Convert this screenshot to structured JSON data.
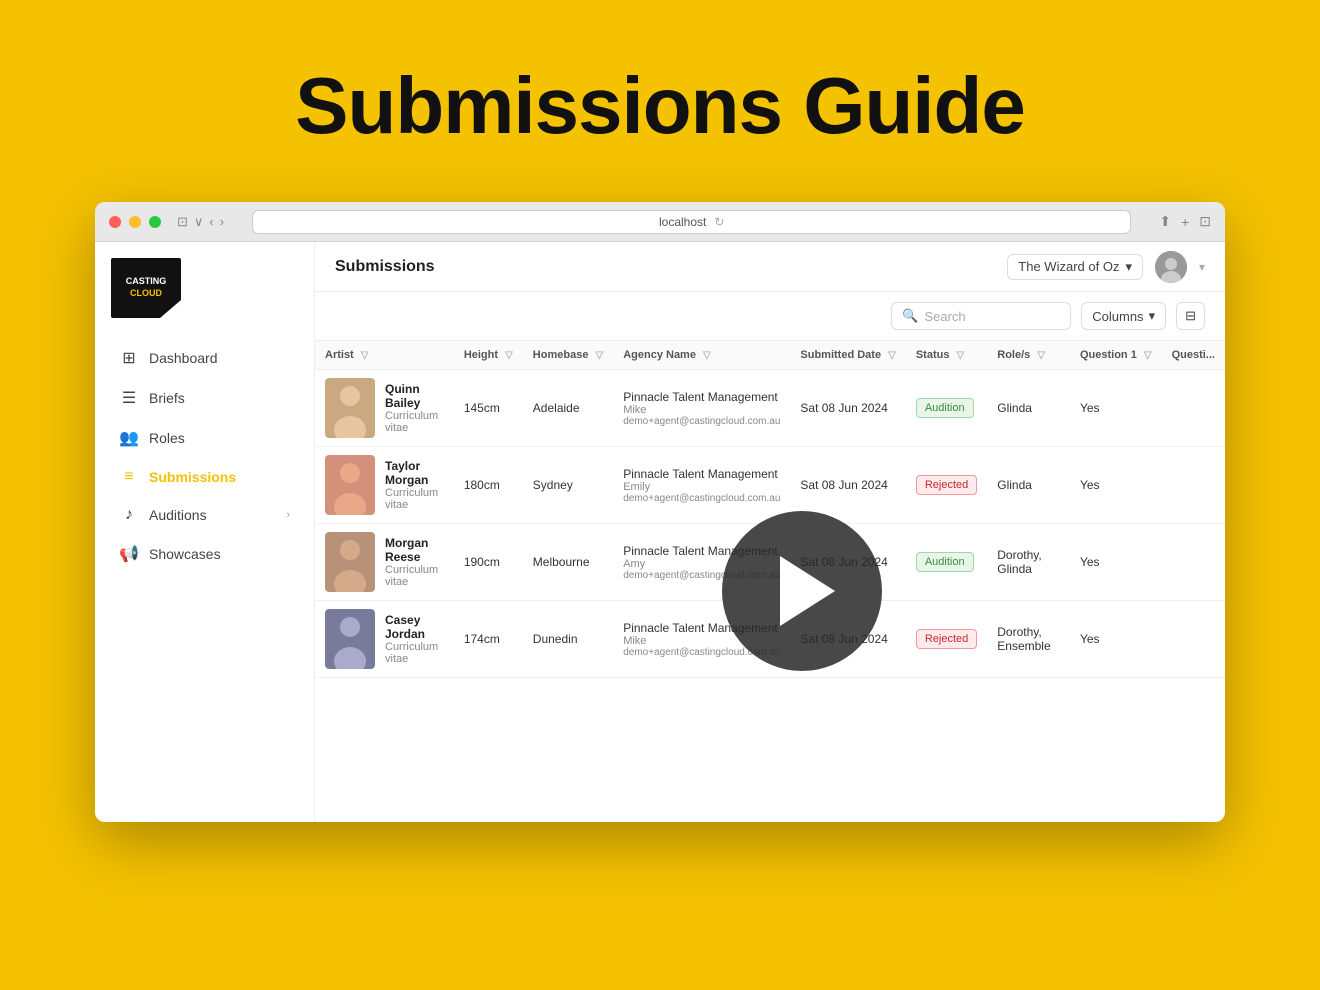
{
  "hero": {
    "title": "Submissions Guide"
  },
  "browser": {
    "url": "localhost",
    "traffic_lights": [
      "red",
      "yellow",
      "green"
    ]
  },
  "topbar": {
    "page_title": "Submissions",
    "project_name": "The Wizard of Oz",
    "user_initial": "👤"
  },
  "toolbar": {
    "search_placeholder": "Search",
    "columns_label": "Columns",
    "filter_icon": "▦"
  },
  "sidebar": {
    "logo_line1": "CASTING",
    "logo_line2": "CLOUD",
    "items": [
      {
        "id": "dashboard",
        "label": "Dashboard",
        "icon": "⊞",
        "active": false
      },
      {
        "id": "briefs",
        "label": "Briefs",
        "icon": "☰",
        "active": false
      },
      {
        "id": "roles",
        "label": "Roles",
        "icon": "👥",
        "active": false
      },
      {
        "id": "submissions",
        "label": "Submissions",
        "icon": "☰",
        "active": true
      },
      {
        "id": "auditions",
        "label": "Auditions",
        "icon": "♪",
        "active": false,
        "hasChevron": true
      },
      {
        "id": "showcases",
        "label": "Showcases",
        "icon": "📢",
        "active": false
      }
    ]
  },
  "table": {
    "columns": [
      {
        "id": "artist",
        "label": "Artist"
      },
      {
        "id": "height",
        "label": "Height"
      },
      {
        "id": "homebase",
        "label": "Homebase"
      },
      {
        "id": "agency_name",
        "label": "Agency Name"
      },
      {
        "id": "submitted_date",
        "label": "Submitted Date"
      },
      {
        "id": "status",
        "label": "Status"
      },
      {
        "id": "roles",
        "label": "Role/s"
      },
      {
        "id": "question1",
        "label": "Question 1"
      },
      {
        "id": "question2",
        "label": "Questi..."
      }
    ],
    "rows": [
      {
        "id": 1,
        "artist_name": "Quinn Bailey",
        "artist_sub": "Curriculum vitae",
        "photo_class": "artist-photo-1",
        "height": "145cm",
        "homebase": "Adelaide",
        "agency_name": "Pinnacle Talent Management",
        "agency_contact": "Mike",
        "agency_email": "demo+agent@castingcloud.com.au",
        "submitted_date": "Sat 08 Jun 2024",
        "status": "Audition",
        "status_class": "status-audition",
        "roles": "Glinda",
        "question1": "Yes"
      },
      {
        "id": 2,
        "artist_name": "Taylor Morgan",
        "artist_sub": "Curriculum vitae",
        "photo_class": "artist-photo-2",
        "height": "180cm",
        "homebase": "Sydney",
        "agency_name": "Pinnacle Talent Management",
        "agency_contact": "Emily",
        "agency_email": "demo+agent@castingcloud.com.au",
        "submitted_date": "Sat 08 Jun 2024",
        "status": "Rejected",
        "status_class": "status-rejected",
        "roles": "Glinda",
        "question1": "Yes"
      },
      {
        "id": 3,
        "artist_name": "Morgan Reese",
        "artist_sub": "Curriculum vitae",
        "photo_class": "artist-photo-3",
        "height": "190cm",
        "homebase": "Melbourne",
        "agency_name": "Pinnacle Talent Management",
        "agency_contact": "Amy",
        "agency_email": "demo+agent@castingcloud.com.au",
        "submitted_date": "Sat 08 Jun 2024",
        "status": "Audition",
        "status_class": "status-audition",
        "roles": "Dorothy, Glinda",
        "question1": "Yes"
      },
      {
        "id": 4,
        "artist_name": "Casey Jordan",
        "artist_sub": "Curriculum vitae",
        "photo_class": "artist-photo-4",
        "height": "174cm",
        "homebase": "Dunedin",
        "agency_name": "Pinnacle Talent Management",
        "agency_contact": "Mike",
        "agency_email": "demo+agent@castingcloud.com.au",
        "submitted_date": "Sat 08 Jun 2024",
        "status": "Rejected",
        "status_class": "status-rejected",
        "roles": "Dorothy, Ensemble",
        "question1": "Yes"
      }
    ]
  }
}
